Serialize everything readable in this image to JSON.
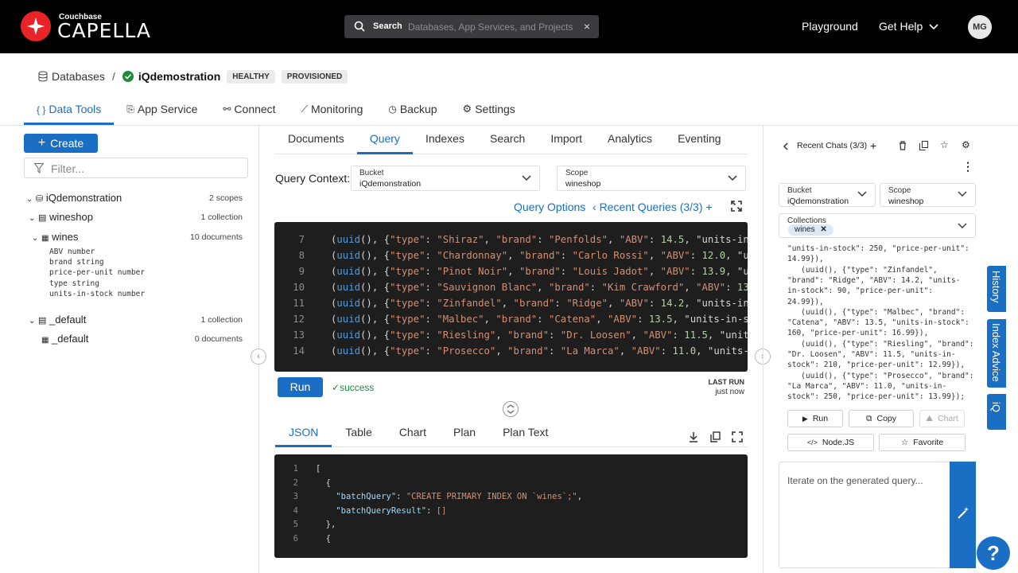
{
  "header": {
    "brand_small": "Couchbase",
    "brand_name": "CAPELLA",
    "search_label": "Search",
    "search_placeholder": "Databases, App Services, and Projects",
    "search_clear": "×",
    "nav_playground": "Playground",
    "nav_help": "Get Help",
    "avatar_initials": "MG"
  },
  "breadcrumb": {
    "root": "Databases",
    "separator": "/",
    "database": "iQdemostration",
    "badges": [
      "HEALTHY",
      "PROVISIONED"
    ]
  },
  "main_tabs": [
    {
      "label": "Data Tools",
      "icon": "braces-icon"
    },
    {
      "label": "App Service",
      "icon": "app-service-icon"
    },
    {
      "label": "Connect",
      "icon": "connect-icon"
    },
    {
      "label": "Monitoring",
      "icon": "chart-icon"
    },
    {
      "label": "Backup",
      "icon": "clock-icon"
    },
    {
      "label": "Settings",
      "icon": "gear-icon"
    }
  ],
  "sidebar": {
    "create_label": "Create",
    "filter_placeholder": "Filter...",
    "tree": {
      "cluster": {
        "name": "iQdemonstration",
        "meta": "2 scopes"
      },
      "scope1": {
        "name": "wineshop",
        "meta": "1 collection"
      },
      "collection1": {
        "name": "wines",
        "meta": "10 documents"
      },
      "fields": [
        "ABV number",
        "brand string",
        "price-per-unit number",
        "type string",
        "units-in-stock number"
      ],
      "scope2": {
        "name": "_default",
        "meta": "1 collection"
      },
      "collection2": {
        "name": "_default",
        "meta": "0 documents"
      }
    }
  },
  "subtabs": [
    "Documents",
    "Query",
    "Indexes",
    "Search",
    "Import",
    "Analytics",
    "Eventing"
  ],
  "query_context": {
    "label": "Query Context:",
    "bucket_label": "Bucket",
    "bucket_value": "iQdemonstration",
    "scope_label": "Scope",
    "scope_value": "wineshop"
  },
  "query_links": {
    "options": "Query Options",
    "recent": "Recent Queries (3/3)"
  },
  "editor": {
    "lines": [
      {
        "n": "7",
        "type": "Shiraz",
        "brand": "Penfolds",
        "abv": "14.5",
        "tail": ", \"units-in-stock"
      },
      {
        "n": "8",
        "type": "Chardonnay",
        "brand": "Carlo Rossi",
        "abv": "12.0",
        "tail": ", \"units-"
      },
      {
        "n": "9",
        "type": "Pinot Noir",
        "brand": "Louis Jadot",
        "abv": "13.9",
        "tail": ", \"units-i"
      },
      {
        "n": "10",
        "type": "Sauvignon Blanc",
        "brand": "Kim Crawford",
        "abv": "13.0",
        "tail": ", \""
      },
      {
        "n": "11",
        "type": "Zinfandel",
        "brand": "Ridge",
        "abv": "14.2",
        "tail": ", \"units-in-stoc"
      },
      {
        "n": "12",
        "type": "Malbec",
        "brand": "Catena",
        "abv": "13.5",
        "tail": ", \"units-in-stock\""
      },
      {
        "n": "13",
        "type": "Riesling",
        "brand": "Dr. Loosen",
        "abv": "11.5",
        "tail": ", \"units-in-"
      },
      {
        "n": "14",
        "type": "Prosecco",
        "brand": "La Marca",
        "abv": "11.0",
        "tail": ", \"units-in-st"
      }
    ]
  },
  "run": {
    "label": "Run",
    "status": "success",
    "last_run_label": "LAST RUN",
    "last_run_value": "just now"
  },
  "result_tabs": [
    "JSON",
    "Table",
    "Chart",
    "Plan",
    "Plan Text"
  ],
  "result": {
    "lines": [
      {
        "n": "1",
        "text": "["
      },
      {
        "n": "2",
        "text": "  {"
      },
      {
        "n": "3",
        "key": "\"batchQuery\"",
        "val": "\"CREATE PRIMARY INDEX ON `wines`;\"",
        "indent": "    ",
        "end": ","
      },
      {
        "n": "4",
        "key": "\"batchQueryResult\"",
        "val": "[]",
        "indent": "    ",
        "end": ""
      },
      {
        "n": "5",
        "text": "  },"
      },
      {
        "n": "6",
        "text": "  {"
      }
    ]
  },
  "assistant": {
    "recent_chats": "Recent Chats (3/3)",
    "bucket_label": "Bucket",
    "bucket_value": "iQdemonstration",
    "scope_label": "Scope",
    "scope_value": "wineshop",
    "collections_label": "Collections",
    "collection_chip": "wines",
    "generated_lines": [
      "\"units-in-stock\": 250, \"price-per-unit\":",
      "14.99}),",
      "   (uuid(), {\"type\": \"Zinfandel\",",
      "\"brand\": \"Ridge\", \"ABV\": 14.2, \"units-",
      "in-stock\": 90, \"price-per-unit\":",
      "24.99}),",
      "   (uuid(), {\"type\": \"Malbec\", \"brand\":",
      "\"Catena\", \"ABV\": 13.5, \"units-in-stock\":",
      "160, \"price-per-unit\": 16.99}),",
      "   (uuid(), {\"type\": \"Riesling\", \"brand\":",
      "\"Dr. Loosen\", \"ABV\": 11.5, \"units-in-",
      "stock\": 210, \"price-per-unit\": 12.99}),",
      "   (uuid(), {\"type\": \"Prosecco\", \"brand\":",
      "\"La Marca\", \"ABV\": 11.0, \"units-in-",
      "stock\": 250, \"price-per-unit\": 13.99});"
    ],
    "btn_run": "Run",
    "btn_copy": "Copy",
    "btn_chart": "Chart",
    "btn_node": "Node.JS",
    "btn_favorite": "Favorite",
    "iterate_placeholder": "Iterate on the generated query..."
  },
  "side_tabs": [
    "History",
    "Index Advice",
    "iQ"
  ],
  "help_label": "?",
  "colors": {
    "accent": "#1a6fc4",
    "brand_red": "#ea2328",
    "success": "#1d8a3c"
  }
}
